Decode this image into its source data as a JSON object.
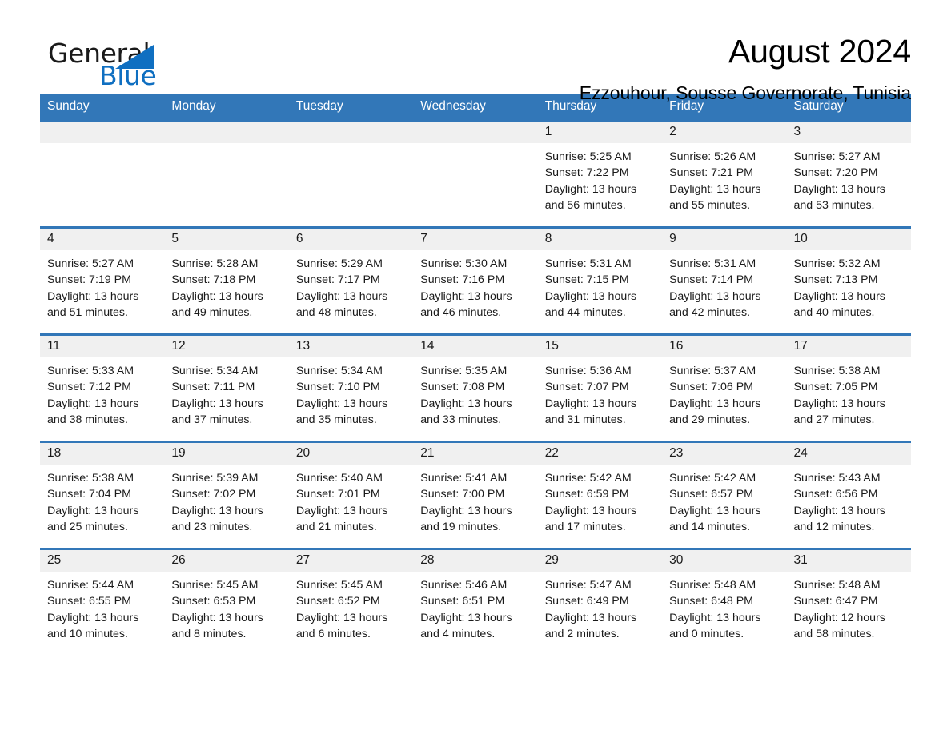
{
  "brand": {
    "name_part1": "General",
    "name_part2": "Blue",
    "accent_color": "#0f6fc1",
    "logo_icon": "triangle-flag-icon"
  },
  "header": {
    "title": "August 2024",
    "subtitle": "Ezzouhour, Sousse Governorate, Tunisia"
  },
  "calendar": {
    "header_bg": "#3277b8",
    "daynum_bg": "#f0f0f0",
    "weekday_headers": [
      "Sunday",
      "Monday",
      "Tuesday",
      "Wednesday",
      "Thursday",
      "Friday",
      "Saturday"
    ],
    "weeks": [
      [
        {
          "day": "",
          "sunrise": "",
          "sunset": "",
          "daylight1": "",
          "daylight2": ""
        },
        {
          "day": "",
          "sunrise": "",
          "sunset": "",
          "daylight1": "",
          "daylight2": ""
        },
        {
          "day": "",
          "sunrise": "",
          "sunset": "",
          "daylight1": "",
          "daylight2": ""
        },
        {
          "day": "",
          "sunrise": "",
          "sunset": "",
          "daylight1": "",
          "daylight2": ""
        },
        {
          "day": "1",
          "sunrise": "Sunrise: 5:25 AM",
          "sunset": "Sunset: 7:22 PM",
          "daylight1": "Daylight: 13 hours",
          "daylight2": "and 56 minutes."
        },
        {
          "day": "2",
          "sunrise": "Sunrise: 5:26 AM",
          "sunset": "Sunset: 7:21 PM",
          "daylight1": "Daylight: 13 hours",
          "daylight2": "and 55 minutes."
        },
        {
          "day": "3",
          "sunrise": "Sunrise: 5:27 AM",
          "sunset": "Sunset: 7:20 PM",
          "daylight1": "Daylight: 13 hours",
          "daylight2": "and 53 minutes."
        }
      ],
      [
        {
          "day": "4",
          "sunrise": "Sunrise: 5:27 AM",
          "sunset": "Sunset: 7:19 PM",
          "daylight1": "Daylight: 13 hours",
          "daylight2": "and 51 minutes."
        },
        {
          "day": "5",
          "sunrise": "Sunrise: 5:28 AM",
          "sunset": "Sunset: 7:18 PM",
          "daylight1": "Daylight: 13 hours",
          "daylight2": "and 49 minutes."
        },
        {
          "day": "6",
          "sunrise": "Sunrise: 5:29 AM",
          "sunset": "Sunset: 7:17 PM",
          "daylight1": "Daylight: 13 hours",
          "daylight2": "and 48 minutes."
        },
        {
          "day": "7",
          "sunrise": "Sunrise: 5:30 AM",
          "sunset": "Sunset: 7:16 PM",
          "daylight1": "Daylight: 13 hours",
          "daylight2": "and 46 minutes."
        },
        {
          "day": "8",
          "sunrise": "Sunrise: 5:31 AM",
          "sunset": "Sunset: 7:15 PM",
          "daylight1": "Daylight: 13 hours",
          "daylight2": "and 44 minutes."
        },
        {
          "day": "9",
          "sunrise": "Sunrise: 5:31 AM",
          "sunset": "Sunset: 7:14 PM",
          "daylight1": "Daylight: 13 hours",
          "daylight2": "and 42 minutes."
        },
        {
          "day": "10",
          "sunrise": "Sunrise: 5:32 AM",
          "sunset": "Sunset: 7:13 PM",
          "daylight1": "Daylight: 13 hours",
          "daylight2": "and 40 minutes."
        }
      ],
      [
        {
          "day": "11",
          "sunrise": "Sunrise: 5:33 AM",
          "sunset": "Sunset: 7:12 PM",
          "daylight1": "Daylight: 13 hours",
          "daylight2": "and 38 minutes."
        },
        {
          "day": "12",
          "sunrise": "Sunrise: 5:34 AM",
          "sunset": "Sunset: 7:11 PM",
          "daylight1": "Daylight: 13 hours",
          "daylight2": "and 37 minutes."
        },
        {
          "day": "13",
          "sunrise": "Sunrise: 5:34 AM",
          "sunset": "Sunset: 7:10 PM",
          "daylight1": "Daylight: 13 hours",
          "daylight2": "and 35 minutes."
        },
        {
          "day": "14",
          "sunrise": "Sunrise: 5:35 AM",
          "sunset": "Sunset: 7:08 PM",
          "daylight1": "Daylight: 13 hours",
          "daylight2": "and 33 minutes."
        },
        {
          "day": "15",
          "sunrise": "Sunrise: 5:36 AM",
          "sunset": "Sunset: 7:07 PM",
          "daylight1": "Daylight: 13 hours",
          "daylight2": "and 31 minutes."
        },
        {
          "day": "16",
          "sunrise": "Sunrise: 5:37 AM",
          "sunset": "Sunset: 7:06 PM",
          "daylight1": "Daylight: 13 hours",
          "daylight2": "and 29 minutes."
        },
        {
          "day": "17",
          "sunrise": "Sunrise: 5:38 AM",
          "sunset": "Sunset: 7:05 PM",
          "daylight1": "Daylight: 13 hours",
          "daylight2": "and 27 minutes."
        }
      ],
      [
        {
          "day": "18",
          "sunrise": "Sunrise: 5:38 AM",
          "sunset": "Sunset: 7:04 PM",
          "daylight1": "Daylight: 13 hours",
          "daylight2": "and 25 minutes."
        },
        {
          "day": "19",
          "sunrise": "Sunrise: 5:39 AM",
          "sunset": "Sunset: 7:02 PM",
          "daylight1": "Daylight: 13 hours",
          "daylight2": "and 23 minutes."
        },
        {
          "day": "20",
          "sunrise": "Sunrise: 5:40 AM",
          "sunset": "Sunset: 7:01 PM",
          "daylight1": "Daylight: 13 hours",
          "daylight2": "and 21 minutes."
        },
        {
          "day": "21",
          "sunrise": "Sunrise: 5:41 AM",
          "sunset": "Sunset: 7:00 PM",
          "daylight1": "Daylight: 13 hours",
          "daylight2": "and 19 minutes."
        },
        {
          "day": "22",
          "sunrise": "Sunrise: 5:42 AM",
          "sunset": "Sunset: 6:59 PM",
          "daylight1": "Daylight: 13 hours",
          "daylight2": "and 17 minutes."
        },
        {
          "day": "23",
          "sunrise": "Sunrise: 5:42 AM",
          "sunset": "Sunset: 6:57 PM",
          "daylight1": "Daylight: 13 hours",
          "daylight2": "and 14 minutes."
        },
        {
          "day": "24",
          "sunrise": "Sunrise: 5:43 AM",
          "sunset": "Sunset: 6:56 PM",
          "daylight1": "Daylight: 13 hours",
          "daylight2": "and 12 minutes."
        }
      ],
      [
        {
          "day": "25",
          "sunrise": "Sunrise: 5:44 AM",
          "sunset": "Sunset: 6:55 PM",
          "daylight1": "Daylight: 13 hours",
          "daylight2": "and 10 minutes."
        },
        {
          "day": "26",
          "sunrise": "Sunrise: 5:45 AM",
          "sunset": "Sunset: 6:53 PM",
          "daylight1": "Daylight: 13 hours",
          "daylight2": "and 8 minutes."
        },
        {
          "day": "27",
          "sunrise": "Sunrise: 5:45 AM",
          "sunset": "Sunset: 6:52 PM",
          "daylight1": "Daylight: 13 hours",
          "daylight2": "and 6 minutes."
        },
        {
          "day": "28",
          "sunrise": "Sunrise: 5:46 AM",
          "sunset": "Sunset: 6:51 PM",
          "daylight1": "Daylight: 13 hours",
          "daylight2": "and 4 minutes."
        },
        {
          "day": "29",
          "sunrise": "Sunrise: 5:47 AM",
          "sunset": "Sunset: 6:49 PM",
          "daylight1": "Daylight: 13 hours",
          "daylight2": "and 2 minutes."
        },
        {
          "day": "30",
          "sunrise": "Sunrise: 5:48 AM",
          "sunset": "Sunset: 6:48 PM",
          "daylight1": "Daylight: 13 hours",
          "daylight2": "and 0 minutes."
        },
        {
          "day": "31",
          "sunrise": "Sunrise: 5:48 AM",
          "sunset": "Sunset: 6:47 PM",
          "daylight1": "Daylight: 12 hours",
          "daylight2": "and 58 minutes."
        }
      ]
    ]
  }
}
